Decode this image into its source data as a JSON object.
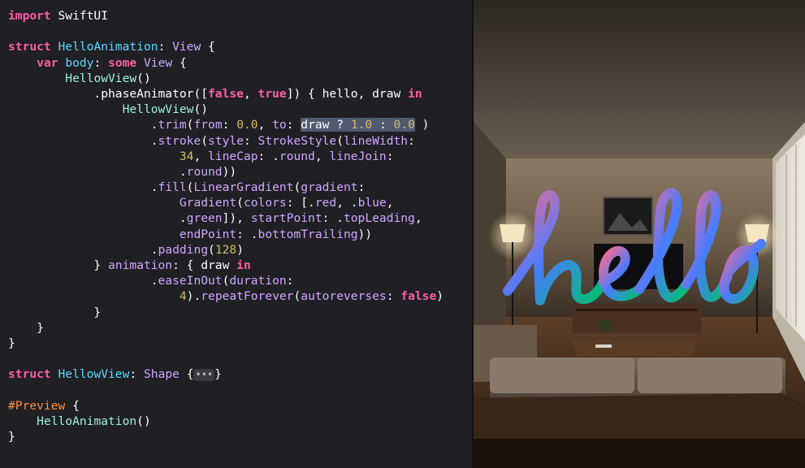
{
  "editor": {
    "lines": [
      [
        {
          "t": "import",
          "c": "kw"
        },
        {
          "t": " SwiftUI",
          "c": "plain"
        }
      ],
      [],
      [
        {
          "t": "struct",
          "c": "kw"
        },
        {
          "t": " ",
          "c": "plain"
        },
        {
          "t": "HelloAnimation",
          "c": "type"
        },
        {
          "t": ": ",
          "c": "plain"
        },
        {
          "t": "View",
          "c": "sys"
        },
        {
          "t": " {",
          "c": "plain"
        }
      ],
      [
        {
          "t": "    ",
          "c": "plain"
        },
        {
          "t": "var",
          "c": "kw"
        },
        {
          "t": " ",
          "c": "plain"
        },
        {
          "t": "body",
          "c": "type"
        },
        {
          "t": ": ",
          "c": "plain"
        },
        {
          "t": "some",
          "c": "kw"
        },
        {
          "t": " ",
          "c": "plain"
        },
        {
          "t": "View",
          "c": "sys"
        },
        {
          "t": " {",
          "c": "plain"
        }
      ],
      [
        {
          "t": "        ",
          "c": "plain"
        },
        {
          "t": "HellowView",
          "c": "usertype"
        },
        {
          "t": "()",
          "c": "plain"
        }
      ],
      [
        {
          "t": "            .phaseAnimator([",
          "c": "plain"
        },
        {
          "t": "false",
          "c": "kw"
        },
        {
          "t": ", ",
          "c": "plain"
        },
        {
          "t": "true",
          "c": "kw"
        },
        {
          "t": "]) { hello, draw ",
          "c": "plain"
        },
        {
          "t": "in",
          "c": "kw"
        }
      ],
      [
        {
          "t": "                ",
          "c": "plain"
        },
        {
          "t": "HellowView",
          "c": "usertype"
        },
        {
          "t": "()",
          "c": "plain"
        }
      ],
      [
        {
          "t": "                    .",
          "c": "plain"
        },
        {
          "t": "trim",
          "c": "sys"
        },
        {
          "t": "(",
          "c": "plain"
        },
        {
          "t": "from",
          "c": "sys"
        },
        {
          "t": ": ",
          "c": "plain"
        },
        {
          "t": "0.0",
          "c": "num"
        },
        {
          "t": ", ",
          "c": "plain"
        },
        {
          "t": "to",
          "c": "sys"
        },
        {
          "t": ": ",
          "c": "plain"
        },
        {
          "t": "draw ? ",
          "c": "hl"
        },
        {
          "t": "1.0",
          "c": "hlnum"
        },
        {
          "t": " : ",
          "c": "hl"
        },
        {
          "t": "0.0",
          "c": "hlnum"
        },
        {
          "t": " )",
          "c": "plain"
        }
      ],
      [
        {
          "t": "                    .",
          "c": "plain"
        },
        {
          "t": "stroke",
          "c": "sys"
        },
        {
          "t": "(",
          "c": "plain"
        },
        {
          "t": "style",
          "c": "sys"
        },
        {
          "t": ": ",
          "c": "plain"
        },
        {
          "t": "StrokeStyle",
          "c": "sys"
        },
        {
          "t": "(",
          "c": "plain"
        },
        {
          "t": "lineWidth",
          "c": "sys"
        },
        {
          "t": ":",
          "c": "plain"
        }
      ],
      [
        {
          "t": "                        ",
          "c": "plain"
        },
        {
          "t": "34",
          "c": "num"
        },
        {
          "t": ", ",
          "c": "plain"
        },
        {
          "t": "lineCap",
          "c": "sys"
        },
        {
          "t": ": .",
          "c": "plain"
        },
        {
          "t": "round",
          "c": "sys"
        },
        {
          "t": ", ",
          "c": "plain"
        },
        {
          "t": "lineJoin",
          "c": "sys"
        },
        {
          "t": ":",
          "c": "plain"
        }
      ],
      [
        {
          "t": "                        .",
          "c": "plain"
        },
        {
          "t": "round",
          "c": "sys"
        },
        {
          "t": "))",
          "c": "plain"
        }
      ],
      [
        {
          "t": "                    .",
          "c": "plain"
        },
        {
          "t": "fill",
          "c": "sys"
        },
        {
          "t": "(",
          "c": "plain"
        },
        {
          "t": "LinearGradient",
          "c": "sys"
        },
        {
          "t": "(",
          "c": "plain"
        },
        {
          "t": "gradient",
          "c": "sys"
        },
        {
          "t": ":",
          "c": "plain"
        }
      ],
      [
        {
          "t": "                        ",
          "c": "plain"
        },
        {
          "t": "Gradient",
          "c": "sys"
        },
        {
          "t": "(",
          "c": "plain"
        },
        {
          "t": "colors",
          "c": "sys"
        },
        {
          "t": ": [.",
          "c": "plain"
        },
        {
          "t": "red",
          "c": "sys"
        },
        {
          "t": ", .",
          "c": "plain"
        },
        {
          "t": "blue",
          "c": "sys"
        },
        {
          "t": ",",
          "c": "plain"
        }
      ],
      [
        {
          "t": "                        .",
          "c": "plain"
        },
        {
          "t": "green",
          "c": "sys"
        },
        {
          "t": "]), ",
          "c": "plain"
        },
        {
          "t": "startPoint",
          "c": "sys"
        },
        {
          "t": ": .",
          "c": "plain"
        },
        {
          "t": "topLeading",
          "c": "sys"
        },
        {
          "t": ",",
          "c": "plain"
        }
      ],
      [
        {
          "t": "                        ",
          "c": "plain"
        },
        {
          "t": "endPoint",
          "c": "sys"
        },
        {
          "t": ": .",
          "c": "plain"
        },
        {
          "t": "bottomTrailing",
          "c": "sys"
        },
        {
          "t": "))",
          "c": "plain"
        }
      ],
      [
        {
          "t": "                    .",
          "c": "plain"
        },
        {
          "t": "padding",
          "c": "sys"
        },
        {
          "t": "(",
          "c": "plain"
        },
        {
          "t": "128",
          "c": "num"
        },
        {
          "t": ")",
          "c": "plain"
        }
      ],
      [
        {
          "t": "            } ",
          "c": "plain"
        },
        {
          "t": "animation",
          "c": "sys"
        },
        {
          "t": ": { draw ",
          "c": "plain"
        },
        {
          "t": "in",
          "c": "kw"
        }
      ],
      [
        {
          "t": "                    .",
          "c": "plain"
        },
        {
          "t": "easeInOut",
          "c": "sys"
        },
        {
          "t": "(",
          "c": "plain"
        },
        {
          "t": "duration",
          "c": "sys"
        },
        {
          "t": ":",
          "c": "plain"
        }
      ],
      [
        {
          "t": "                        ",
          "c": "plain"
        },
        {
          "t": "4",
          "c": "num"
        },
        {
          "t": ").",
          "c": "plain"
        },
        {
          "t": "repeatForever",
          "c": "sys"
        },
        {
          "t": "(",
          "c": "plain"
        },
        {
          "t": "autoreverses",
          "c": "sys"
        },
        {
          "t": ": ",
          "c": "plain"
        },
        {
          "t": "false",
          "c": "kw"
        },
        {
          "t": ")",
          "c": "plain"
        }
      ],
      [
        {
          "t": "            }",
          "c": "plain"
        }
      ],
      [
        {
          "t": "    }",
          "c": "plain"
        }
      ],
      [
        {
          "t": "}",
          "c": "plain"
        }
      ],
      [],
      [
        {
          "t": "struct",
          "c": "kw"
        },
        {
          "t": " ",
          "c": "plain"
        },
        {
          "t": "HellowView",
          "c": "type"
        },
        {
          "t": ": ",
          "c": "plain"
        },
        {
          "t": "Shape",
          "c": "sys"
        },
        {
          "t": " {",
          "c": "plain"
        },
        {
          "t": "•••",
          "c": "fold"
        },
        {
          "t": "}",
          "c": "plain"
        }
      ],
      [],
      [
        {
          "t": "#Preview",
          "c": "macro"
        },
        {
          "t": " {",
          "c": "plain"
        }
      ],
      [
        {
          "t": "    ",
          "c": "plain"
        },
        {
          "t": "HelloAnimation",
          "c": "usertype"
        },
        {
          "t": "()",
          "c": "plain"
        }
      ],
      [
        {
          "t": "}",
          "c": "plain"
        }
      ]
    ]
  },
  "preview": {
    "hello_text": "hello",
    "gradient_colors": [
      "#ff6b8a",
      "#4a7bff",
      "#00c26a"
    ]
  },
  "colors": {
    "keyword": "#fc5fa3",
    "type": "#5dd8ff",
    "user_type": "#9ef1dd",
    "system": "#d0a8ff",
    "number": "#d0bf69",
    "macro": "#fd8f3f",
    "highlight_bg": "#515b70"
  }
}
